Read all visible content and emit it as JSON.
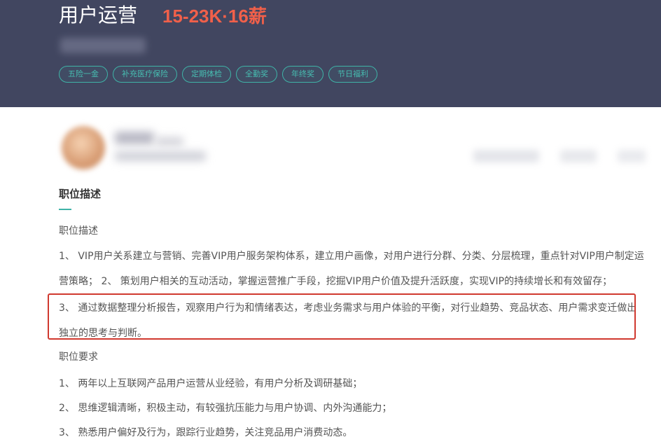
{
  "job": {
    "title": "用户运营",
    "salary": "15-23K·16薪"
  },
  "tags": [
    "五险一金",
    "补充医疗保险",
    "定期体检",
    "全勤奖",
    "年终奖",
    "节日福利"
  ],
  "section": {
    "title": "职位描述"
  },
  "description": {
    "heading": "职位描述",
    "line1": "1、 VIP用户关系建立与营销、完善VIP用户服务架构体系，建立用户画像，对用户进行分群、分类、分层梳理，重点针对VIP用户制定运",
    "line2": "营策略； 2、 策划用户相关的互动活动，掌握运营推广手段，挖掘VIP用户价值及提升活跃度，实现VIP的持续增长和有效留存；",
    "line3": "3、 通过数据整理分析报告，观察用户行为和情绪表达，考虑业务需求与用户体验的平衡，对行业趋势、竞品状态、用户需求变迁做出",
    "line4": "独立的思考与判断。"
  },
  "requirements": {
    "heading": "职位要求",
    "line1": "1、 两年以上互联网产品用户运营从业经验，有用户分析及调研基础；",
    "line2": "2、 思维逻辑清晰，积极主动，有较强抗压能力与用户协调、内外沟通能力；",
    "line3": "3、 熟悉用户偏好及行为，跟踪行业趋势，关注竞品用户消费动态。"
  },
  "colors": {
    "header_bg": "#414660",
    "salary": "#f0604a",
    "tag_accent": "#3fb3a7",
    "highlight_box": "#d0392f"
  }
}
